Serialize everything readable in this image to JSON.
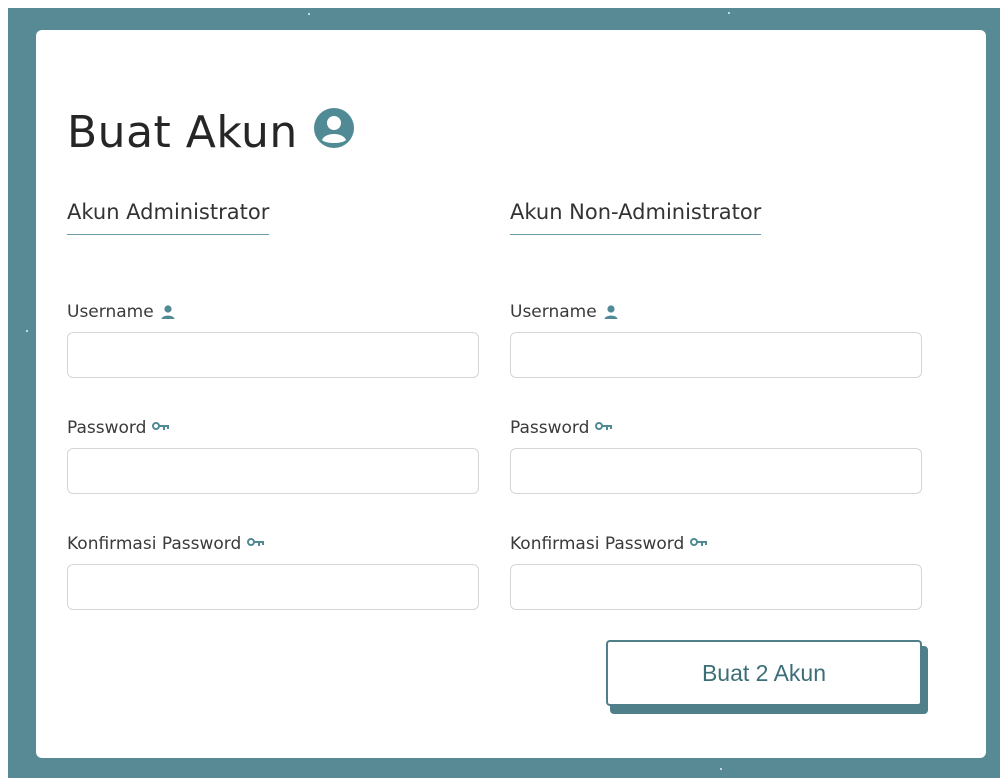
{
  "page": {
    "title": "Buat Akun",
    "title_icon": "user-circle-icon",
    "accent_color": "#4f8a95",
    "frame_color": "#578a94"
  },
  "admin": {
    "heading": "Akun Administrator",
    "username_label": "Username",
    "username_value": "",
    "password_label": "Password",
    "password_value": "",
    "confirm_label": "Konfirmasi Password",
    "confirm_value": ""
  },
  "nonadmin": {
    "heading": "Akun Non-Administrator",
    "username_label": "Username",
    "username_value": "",
    "password_label": "Password",
    "password_value": "",
    "confirm_label": "Konfirmasi Password",
    "confirm_value": ""
  },
  "actions": {
    "submit_label": "Buat 2 Akun"
  }
}
